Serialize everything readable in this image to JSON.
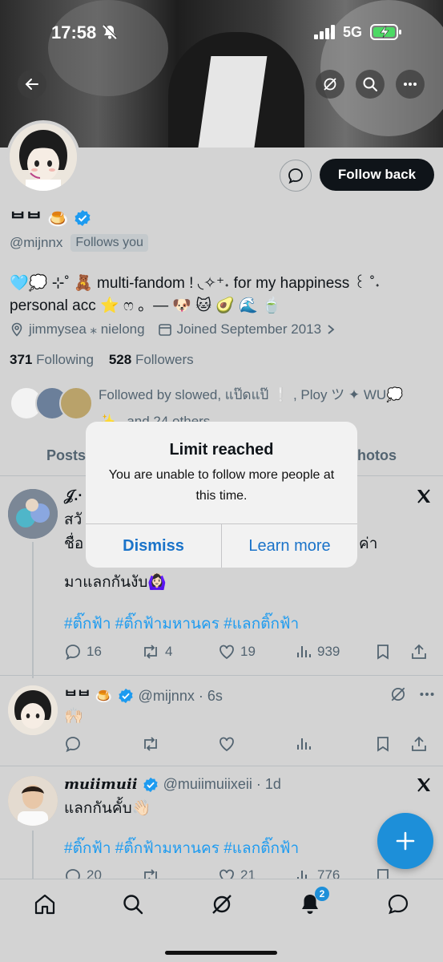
{
  "status_bar": {
    "time": "17:58",
    "network": "5G"
  },
  "profile": {
    "display_name": "ᄇᄇ 🍮",
    "handle": "@mijnnx",
    "follows_you": "Follows you",
    "follow_back": "Follow back",
    "bio_line1": "🩵💭 ⊹˚ 🧸 multi-fandom ! ◟✧⁺˖ for my happiness ꒰ ˚˖",
    "bio_line2": "personal acc ⭐ ෆ 。— 🐶 🐱 🥑 🌊 🍵",
    "location": "jimmysea ⁎ nielong",
    "joined": "Joined September 2013",
    "following_count": "371",
    "following_label": "Following",
    "followers_count": "528",
    "followers_label": "Followers",
    "followed_by_line1": "Followed by slowed, แป๊ดแป๊ ❕ , Ploy ツ ✦ WU💭",
    "followed_by_line2": "✨ , and 24 others"
  },
  "tabs": [
    "Posts",
    "Photos"
  ],
  "dialog": {
    "title": "Limit reached",
    "message": "You are unable to follow more people at this time.",
    "dismiss": "Dismiss",
    "learn_more": "Learn more"
  },
  "posts": [
    {
      "author": "𝒥.·",
      "text_line1": "สวั",
      "text_line2": "ชื่อ",
      "text_line2_end": "ค่า",
      "text_line3": "มาแลกกันงับ🙆🏻‍♀️",
      "hashtags": "#ติ๊กฟ้า #ติ๊กฟ้ามหานคร #แลกติ๊กฟ้า",
      "replies": "16",
      "reposts": "4",
      "likes": "19",
      "views": "939"
    },
    {
      "author": "ᄇᄇ 🍮",
      "handle_time": "@mijnnx · 6s",
      "text": "🙌🏻"
    },
    {
      "author": "muiimuii",
      "handle_time": "@muiimuiixeii · 1d",
      "text": "แลกกันคั้บ👋🏻",
      "hashtags": "#ติ๊กฟ้า #ติ๊กฟ้ามหานคร #แลกติ๊กฟ้า",
      "replies": "20",
      "likes": "21",
      "views": "776"
    }
  ],
  "tabbar": {
    "notification_badge": "2"
  },
  "colors": {
    "accent": "#1d9bf0",
    "dialog_button": "#1a73c9",
    "follow_button": "#0f1419"
  }
}
